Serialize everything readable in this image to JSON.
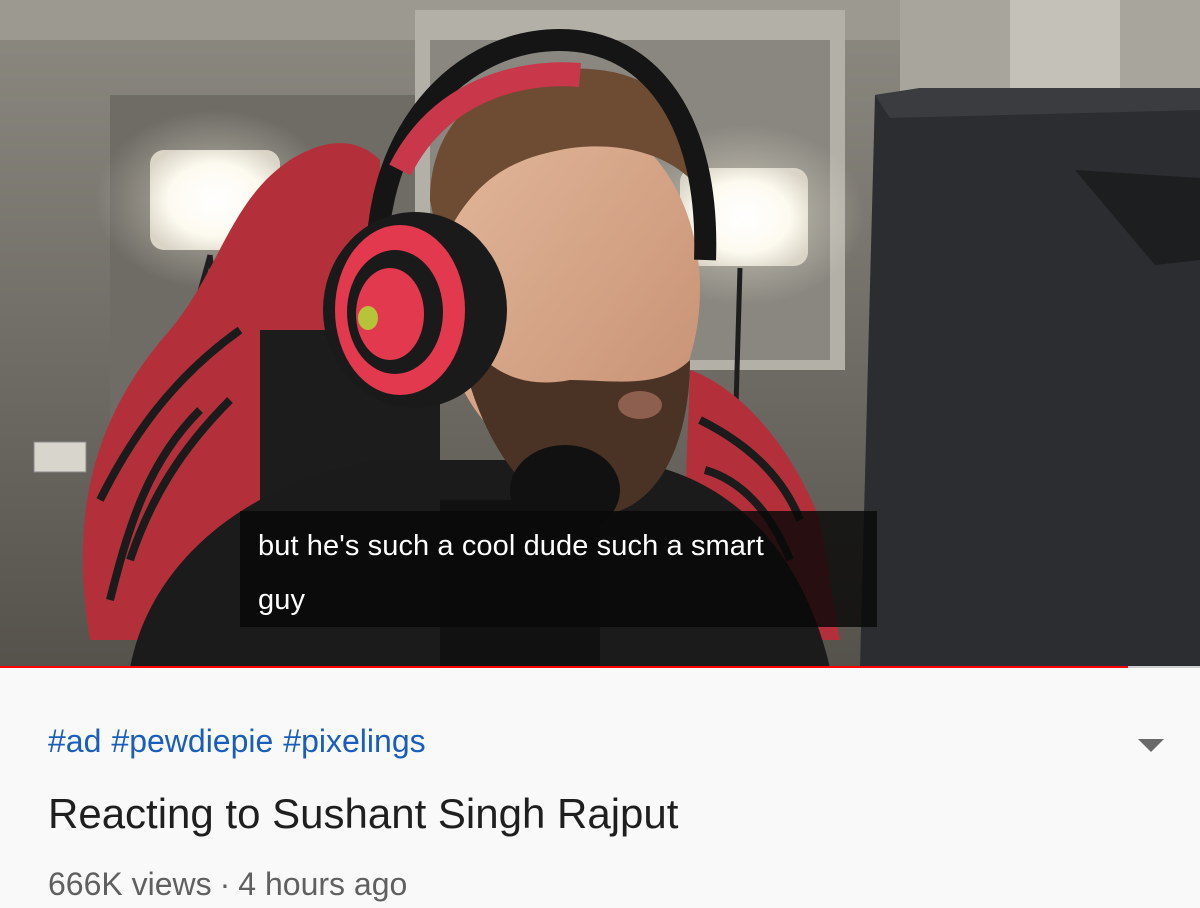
{
  "video": {
    "caption_line_1": "but he's such a cool dude such a smart",
    "caption_line_2": "guy",
    "progress_fraction": 0.94,
    "colors": {
      "progress": "#ff0000",
      "progress_track": "#cfcfcf",
      "caption_bg": "#0a0a0a"
    }
  },
  "details": {
    "hashtags": [
      "#ad",
      "#pewdiepie",
      "#pixelings"
    ],
    "title": "Reacting to Sushant Singh Rajput",
    "views": "666K views",
    "separator": "·",
    "age": "4 hours ago",
    "expand_icon": "chevron-down-icon",
    "colors": {
      "hashtag": "#1a5ebd",
      "title": "#1f1f1f",
      "meta": "#606060"
    }
  }
}
